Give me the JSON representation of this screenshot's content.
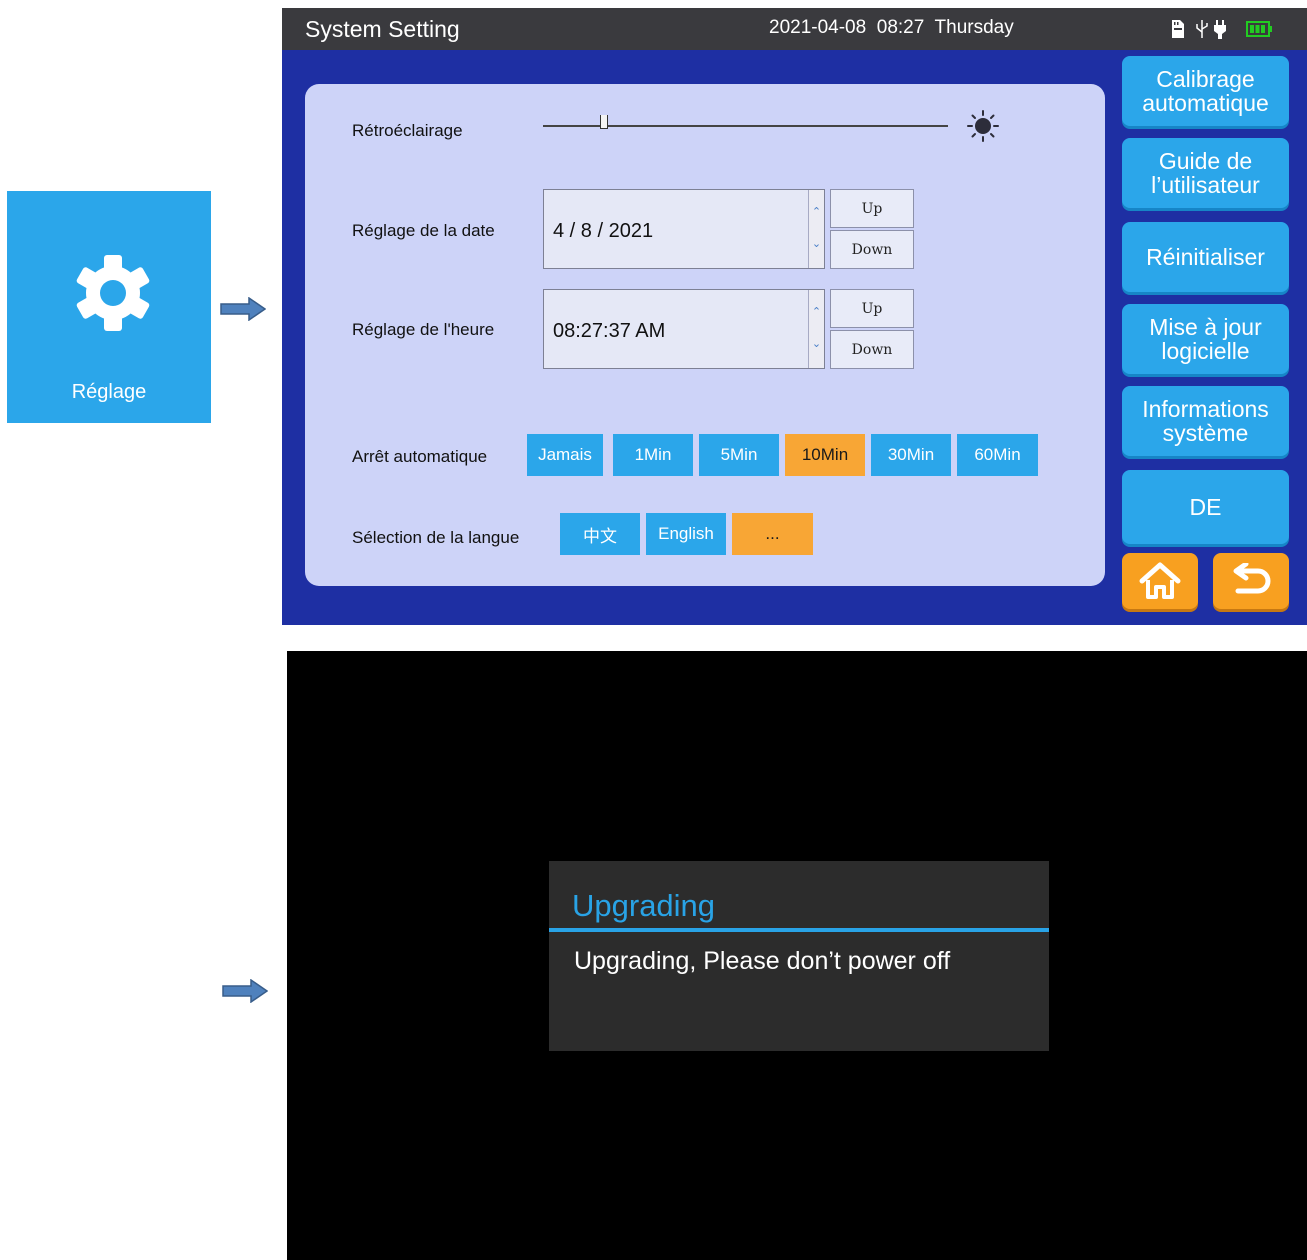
{
  "tile": {
    "label": "Réglage",
    "icon": "gear-icon"
  },
  "header": {
    "title": "System Setting",
    "date": "2021-04-08",
    "time": "08:27",
    "weekday": "Thursday",
    "status_icons": [
      "sd-card-icon",
      "usb-icon",
      "power-plug-icon",
      "battery-icon"
    ]
  },
  "settings": {
    "backlight": {
      "label": "Rétroéclairage",
      "level": 0.15
    },
    "date": {
      "label": "Réglage de la date",
      "value": "4 / 8 / 2021",
      "up": "Up",
      "down": "Down"
    },
    "time": {
      "label": "Réglage de l'heure",
      "value": "08:27:37 AM",
      "up": "Up",
      "down": "Down"
    },
    "auto_off": {
      "label": "Arrêt automatique",
      "options": [
        "Jamais",
        "1Min",
        "5Min",
        "10Min",
        "30Min",
        "60Min"
      ],
      "selected": "10Min"
    },
    "language": {
      "label": "Sélection de la langue",
      "options": [
        "中文",
        "English",
        "..."
      ],
      "selected": "..."
    }
  },
  "side_buttons": {
    "calibration": "Calibrage\nautomatique",
    "guide": "Guide de\nl’utilisateur",
    "reset": "Réinitialiser",
    "update": "Mise à jour\nlogicielle",
    "info": "Informations\nsystème",
    "lang": "DE"
  },
  "colors": {
    "accent_blue": "#2ba6ea",
    "accent_orange": "#f8a635",
    "screen_background": "#1e2fa3",
    "panel": "#cdd3f8"
  },
  "dialog": {
    "title": "Upgrading",
    "message": "Upgrading, Please don’t power off"
  }
}
